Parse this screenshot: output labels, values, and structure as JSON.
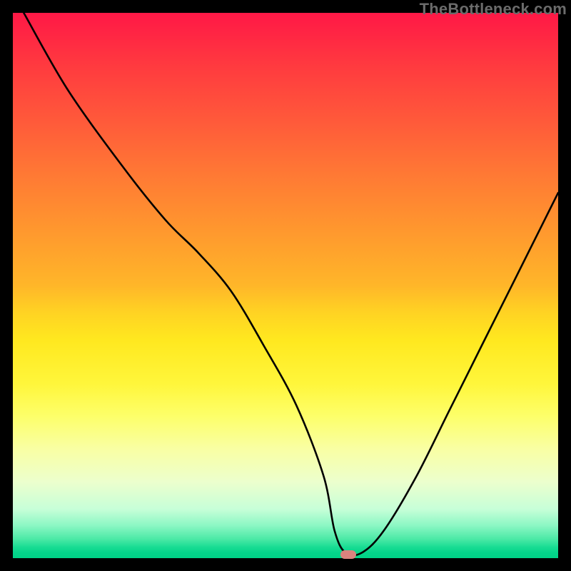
{
  "watermark": "TheBottleneck.com",
  "marker": {
    "x_pct": 61.5,
    "y_pct": 99.3
  },
  "chart_data": {
    "type": "line",
    "title": "",
    "xlabel": "",
    "ylabel": "",
    "xlim": [
      0,
      100
    ],
    "ylim": [
      0,
      100
    ],
    "x": [
      2,
      10,
      20,
      28,
      34,
      40,
      46,
      52,
      57,
      59,
      61,
      64,
      68,
      74,
      80,
      86,
      92,
      98,
      100
    ],
    "values": [
      100,
      86,
      72,
      62,
      56,
      49,
      39,
      28,
      15,
      5,
      1,
      1,
      5,
      15,
      27,
      39,
      51,
      63,
      67
    ],
    "gradient_stops": [
      {
        "pct": 0,
        "color": "#ff1846"
      },
      {
        "pct": 50,
        "color": "#ffd323"
      },
      {
        "pct": 80,
        "color": "#f9ffa4"
      },
      {
        "pct": 100,
        "color": "#00d286"
      }
    ],
    "marker": {
      "x": 61.5,
      "y": 0.7,
      "color": "#d9837e"
    }
  }
}
